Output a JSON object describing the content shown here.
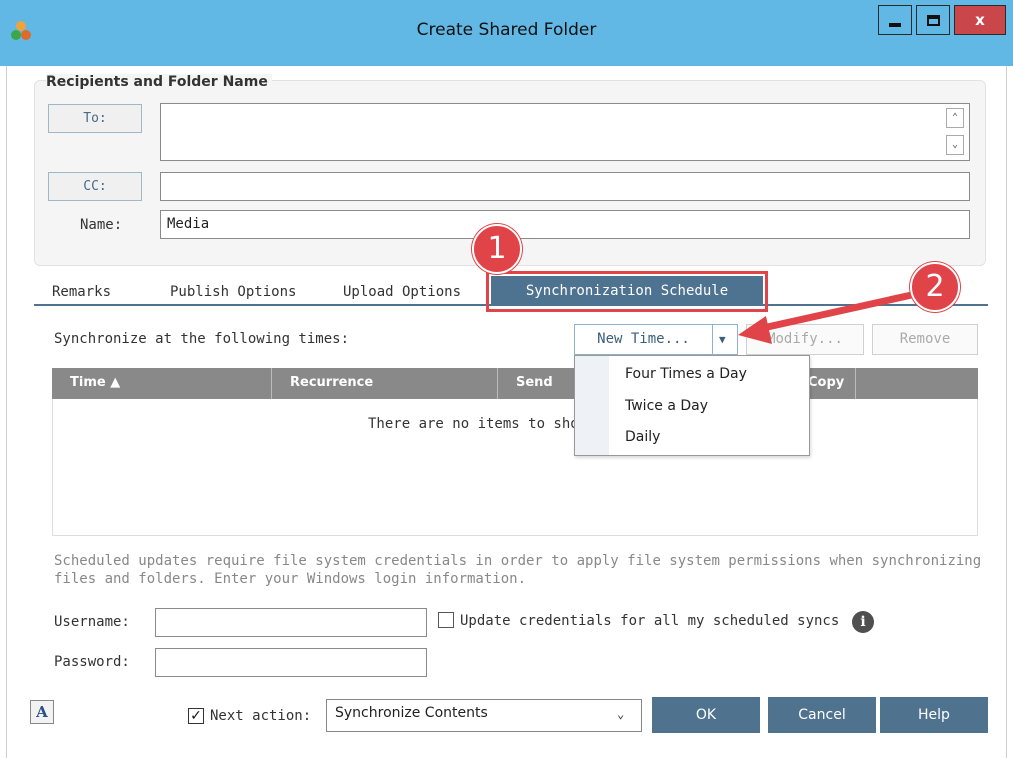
{
  "window": {
    "title": "Create Shared Folder",
    "close_label": "x"
  },
  "recipients": {
    "group_title": "Recipients and Folder Name",
    "to_label": "To:",
    "to_value": "",
    "cc_label": "CC:",
    "cc_value": "",
    "name_label": "Name:",
    "name_value": "Media"
  },
  "tabs": [
    {
      "label": "Remarks"
    },
    {
      "label": "Publish Options"
    },
    {
      "label": "Upload Options"
    },
    {
      "label": "Synchronization Schedule",
      "active": true
    }
  ],
  "annotations": {
    "badge_1": "1",
    "badge_2": "2",
    "highlight_color": "#e04448"
  },
  "schedule": {
    "label": "Synchronize at the following times:",
    "new_time_label": "New Time...",
    "modify_label": "Modify...",
    "remove_label": "Remove",
    "columns": [
      "Time ▲",
      "Recurrence",
      "Send",
      "Copy"
    ],
    "empty_message": "There are no items to show.",
    "menu_items": [
      "Four Times a Day",
      "Twice a Day",
      "Daily"
    ]
  },
  "credentials": {
    "note": "Scheduled updates require file system credentials in order to apply file system permissions when synchronizing files and folders. Enter your Windows login information.",
    "username_label": "Username:",
    "password_label": "Password:",
    "username_value": "",
    "password_value": "",
    "update_all_label": "Update credentials for all my scheduled syncs",
    "update_all_checked": false,
    "info_icon": "i"
  },
  "footer": {
    "spell_icon": "A",
    "next_action_label": "Next action:",
    "next_action_checked": true,
    "next_action_value": "Synchronize Contents",
    "ok_label": "OK",
    "cancel_label": "Cancel",
    "help_label": "Help"
  },
  "colors": {
    "titlebar": "#61b8e5",
    "accent": "#4d7390",
    "button": "#4f738f",
    "close": "#c9474b"
  }
}
